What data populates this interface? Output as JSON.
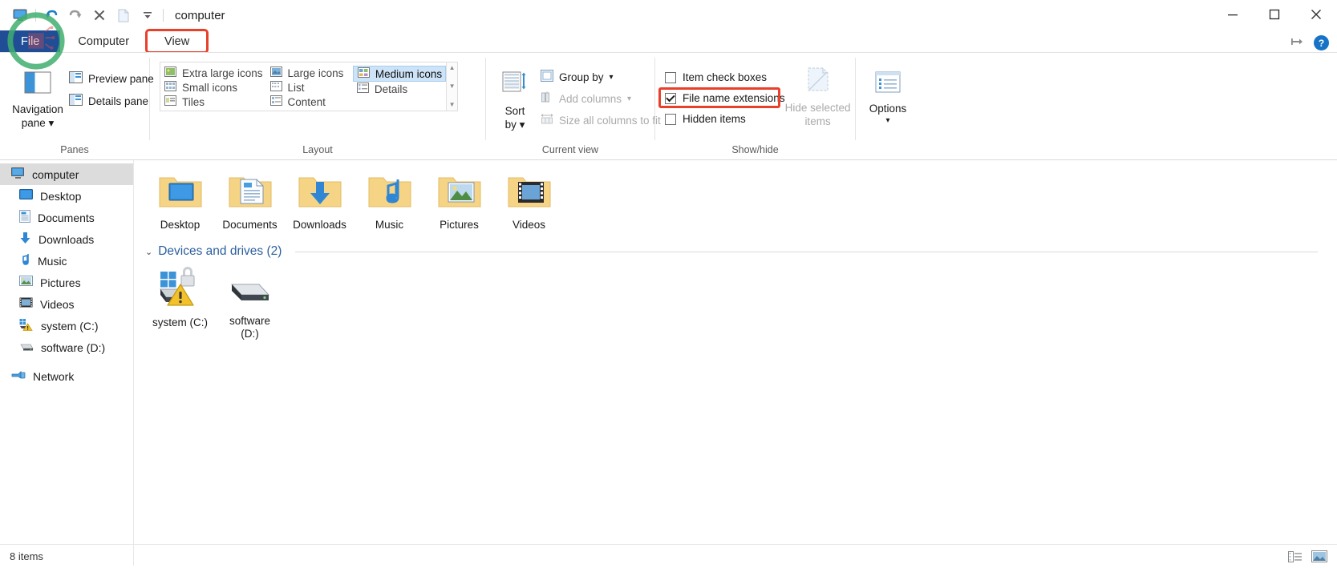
{
  "window": {
    "title": "computer",
    "quick_access": [
      {
        "name": "computer-icon",
        "label": "Computer"
      },
      {
        "name": "undo-icon",
        "label": "Undo"
      },
      {
        "name": "redo-icon",
        "label": "Redo"
      },
      {
        "name": "delete-icon",
        "label": "Delete"
      },
      {
        "name": "properties-icon",
        "label": "Properties"
      },
      {
        "name": "customize-dropdown-icon",
        "label": "Customize Quick Access Toolbar"
      }
    ],
    "controls": {
      "minimize": "Minimize",
      "maximize": "Maximize",
      "close": "Close"
    }
  },
  "tabs": [
    {
      "label": "File",
      "id": "file"
    },
    {
      "label": "Computer",
      "id": "computer"
    },
    {
      "label": "View",
      "id": "view"
    }
  ],
  "active_tab": "View",
  "ribbon_right": {
    "pin_label": "Collapse the Ribbon",
    "help_label": "?"
  },
  "ribbon": {
    "panes": {
      "group_label": "Panes",
      "navigation_pane": "Navigation\npane",
      "navigation_pane_line1": "Navigation",
      "navigation_pane_line2": "pane",
      "preview_pane": "Preview pane",
      "details_pane": "Details pane"
    },
    "layout": {
      "group_label": "Layout",
      "options": [
        {
          "label": "Extra large icons",
          "selected": false
        },
        {
          "label": "Large icons",
          "selected": false
        },
        {
          "label": "Medium icons",
          "selected": true
        },
        {
          "label": "Small icons",
          "selected": false
        },
        {
          "label": "List",
          "selected": false
        },
        {
          "label": "Details",
          "selected": false
        },
        {
          "label": "Tiles",
          "selected": false
        },
        {
          "label": "Content",
          "selected": false
        }
      ]
    },
    "current_view": {
      "group_label": "Current view",
      "sort_by_line1": "Sort",
      "sort_by_line2": "by",
      "group_by": "Group by",
      "add_columns": "Add columns",
      "size_all_columns": "Size all columns to fit",
      "add_columns_disabled": true,
      "size_all_columns_disabled": true
    },
    "show_hide": {
      "group_label": "Show/hide",
      "item_check_boxes": {
        "label": "Item check boxes",
        "checked": false
      },
      "file_name_extensions": {
        "label": "File name extensions",
        "checked": true,
        "highlighted": true
      },
      "hidden_items": {
        "label": "Hidden items",
        "checked": false
      },
      "hide_selected_line1": "Hide selected",
      "hide_selected_line2": "items",
      "hide_selected_disabled": true
    },
    "options": {
      "label": "Options"
    }
  },
  "navigation_pane": {
    "items": [
      {
        "label": "computer",
        "icon": "computer-icon",
        "selected": true,
        "level": 0
      },
      {
        "label": "Desktop",
        "icon": "desktop-icon",
        "selected": false,
        "level": 1
      },
      {
        "label": "Documents",
        "icon": "documents-icon",
        "selected": false,
        "level": 1
      },
      {
        "label": "Downloads",
        "icon": "downloads-icon",
        "selected": false,
        "level": 1
      },
      {
        "label": "Music",
        "icon": "music-icon",
        "selected": false,
        "level": 1
      },
      {
        "label": "Pictures",
        "icon": "pictures-icon",
        "selected": false,
        "level": 1
      },
      {
        "label": "Videos",
        "icon": "videos-icon",
        "selected": false,
        "level": 1
      },
      {
        "label": "system (C:)",
        "icon": "system-drive-icon",
        "selected": false,
        "level": 1
      },
      {
        "label": "software (D:)",
        "icon": "drive-icon",
        "selected": false,
        "level": 1
      },
      {
        "label": "Network",
        "icon": "network-icon",
        "selected": false,
        "level": 0
      }
    ]
  },
  "file_pane": {
    "folders": [
      {
        "label": "Desktop",
        "icon": "desktop-folder-icon"
      },
      {
        "label": "Documents",
        "icon": "documents-folder-icon"
      },
      {
        "label": "Downloads",
        "icon": "downloads-folder-icon"
      },
      {
        "label": "Music",
        "icon": "music-folder-icon"
      },
      {
        "label": "Pictures",
        "icon": "pictures-folder-icon"
      },
      {
        "label": "Videos",
        "icon": "videos-folder-icon"
      }
    ],
    "devices_group": {
      "header": "Devices and drives (2)",
      "expanded": true,
      "drives": [
        {
          "label": "system (C:)",
          "icon": "system-drive-locked-icon",
          "warning": true
        },
        {
          "label_line1": "software",
          "label_line2": "(D:)",
          "icon": "drive-icon",
          "warning": false
        }
      ]
    }
  },
  "status_bar": {
    "item_count": "8 items",
    "view_details_label": "Details view",
    "view_large_icons_label": "Large icons view"
  },
  "colors": {
    "file_tab_blue": "#1f4e96",
    "annotation_red": "#e8402a",
    "watermark_green": "#3fae6e",
    "group_header_blue": "#2b5f9e",
    "selection_blue": "#cde3f7"
  }
}
